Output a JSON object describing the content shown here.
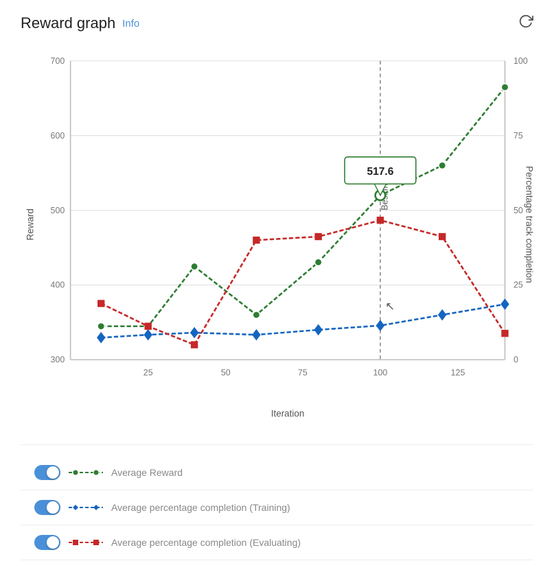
{
  "header": {
    "title": "Reward graph",
    "info_label": "Info",
    "refresh_icon": "↻"
  },
  "chart": {
    "y_left_label": "Reward",
    "y_right_label": "Percentage track completion",
    "x_label": "Iteration",
    "y_left_ticks": [
      "700",
      "600",
      "500",
      "400",
      "300"
    ],
    "y_right_ticks": [
      "100",
      "75",
      "50",
      "25",
      "0"
    ],
    "x_ticks": [
      "25",
      "50",
      "75",
      "100",
      "125"
    ],
    "best_model_label": "Best model",
    "tooltip_value": "517.6"
  },
  "legend": {
    "items": [
      {
        "id": "avg-reward",
        "label": "Average Reward",
        "color": "#2e7d32",
        "dash": true,
        "dot_shape": "circle"
      },
      {
        "id": "avg-pct-training",
        "label": "Average percentage completion (Training)",
        "color": "#1565c0",
        "dash": true,
        "dot_shape": "diamond"
      },
      {
        "id": "avg-pct-evaluating",
        "label": "Average percentage completion (Evaluating)",
        "color": "#c62828",
        "dash": true,
        "dot_shape": "square"
      }
    ]
  }
}
